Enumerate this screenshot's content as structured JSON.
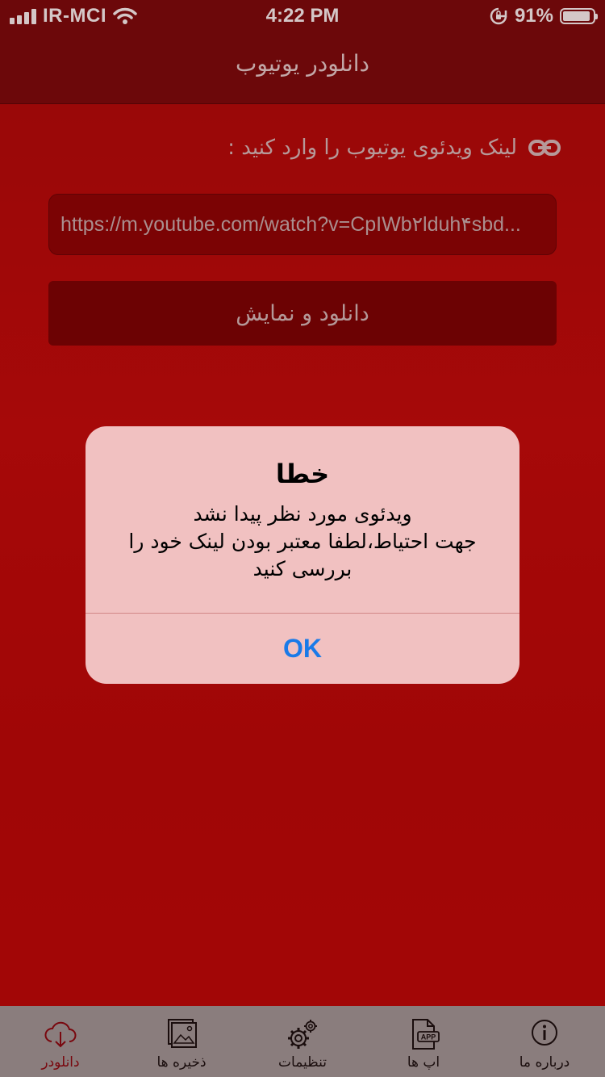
{
  "status_bar": {
    "carrier": "IR-MCI",
    "time": "4:22 PM",
    "battery": "91%",
    "battery_level": 0.91,
    "icons": [
      "signal-icon",
      "wifi-icon",
      "orientation-lock-icon",
      "battery-icon"
    ]
  },
  "nav": {
    "title": "دانلودر یوتیوب"
  },
  "form": {
    "link_label": "لینک ویدئوی یوتیوب را وارد کنید :",
    "link_icon": "link-icon",
    "url_value": "https://m.youtube.com/watch?v=CpIWb۲lduh۴sbd...",
    "download_button": "دانلود و نمایش"
  },
  "tabs": [
    {
      "label": "دانلودر",
      "icon": "cloud-download-icon",
      "active": true
    },
    {
      "label": "ذخیره ها",
      "icon": "gallery-icon",
      "active": false
    },
    {
      "label": "تنظیمات",
      "icon": "gears-icon",
      "active": false
    },
    {
      "label": "اپ ها",
      "icon": "app-file-icon",
      "active": false
    },
    {
      "label": "درباره ما",
      "icon": "info-icon",
      "active": false
    }
  ],
  "alert": {
    "title": "خطا",
    "message_lines": [
      "ویدئوی مورد نظر پیدا نشد",
      "جهت احتیاط،لطفا معتبر بودن لینک خود را",
      "بررسی کنید"
    ],
    "ok_label": "OK"
  },
  "colors": {
    "background": "#c00808",
    "nav_bar": "#7a0b0e",
    "tab_bar": "#a0a0a0",
    "active_tab": "#8b0a12",
    "alert_background": "#f1c1c1",
    "ok_button": "#1a7ae8"
  }
}
